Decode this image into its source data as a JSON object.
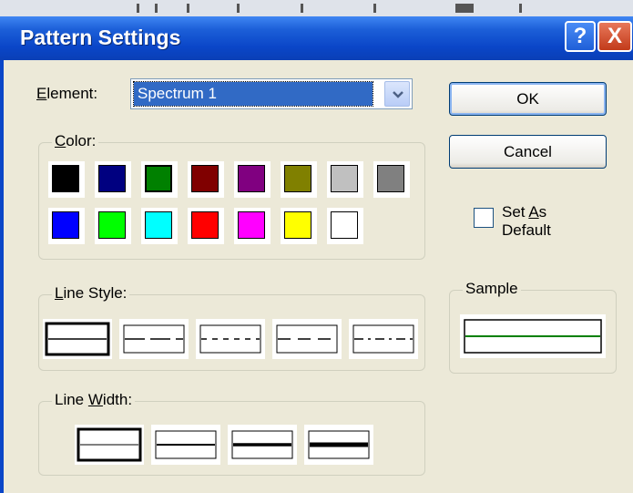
{
  "window": {
    "title": "Pattern Settings"
  },
  "title_buttons": {
    "help": "?",
    "close": "X"
  },
  "element": {
    "label_underline": "E",
    "label_rest": "lement:",
    "value": "Spectrum 1"
  },
  "color_group": {
    "label_underline": "C",
    "label_rest": "olor:"
  },
  "colors": [
    "#000000",
    "#000080",
    "#008000",
    "#800000",
    "#800080",
    "#808000",
    "#c0c0c0",
    "#808080",
    "#0000ff",
    "#00ff00",
    "#00ffff",
    "#ff0000",
    "#ff00ff",
    "#ffff00",
    "#ffffff"
  ],
  "selected_color": "#008000",
  "line_style_group": {
    "label_underline": "L",
    "label_rest": "ine Style:"
  },
  "line_width_group": {
    "label_prefix": "Line ",
    "label_underline": "W",
    "label_rest": "idth:"
  },
  "sample": {
    "label": "Sample",
    "line_color": "#008000"
  },
  "buttons": {
    "ok": "OK",
    "cancel": "Cancel"
  },
  "set_default": {
    "line1_prefix": "Set ",
    "line1_underline": "A",
    "line1_rest": "s",
    "line2": "Default",
    "checked": false
  }
}
